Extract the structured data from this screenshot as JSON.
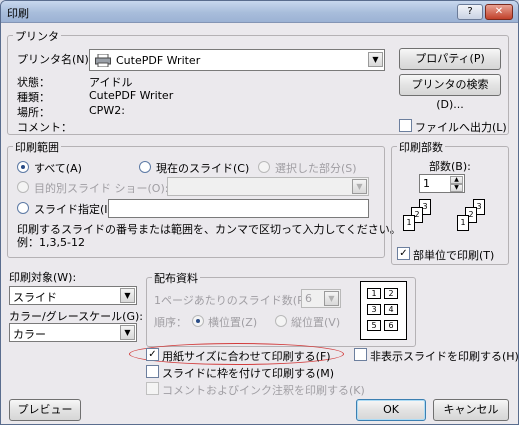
{
  "window": {
    "title": "印刷",
    "help": "?",
    "close": "✕"
  },
  "printer": {
    "legend": "プリンタ",
    "name_label": "プリンタ名(N):",
    "name_value": "CutePDF Writer",
    "properties_button": "プロパティ(P)",
    "find_button": "プリンタの検索(D)...",
    "status_label": "状態：",
    "status_value": "アイドル",
    "type_label": "種類：",
    "type_value": "CutePDF Writer",
    "where_label": "場所：",
    "where_value": "CPW2:",
    "comment_label": "コメント：",
    "print_to_file": "ファイルへ出力(L)"
  },
  "range": {
    "legend": "印刷範囲",
    "all": "すべて(A)",
    "current": "現在のスライド(C)",
    "selection": "選択した部分(S)",
    "custom_show": "目的別スライド ショー(O):",
    "slides": "スライド指定(I):",
    "hint_line1": "印刷するスライドの番号または範囲を、カンマで区切って入力してください。",
    "hint_line2": "例：1,3,5-12"
  },
  "copies": {
    "legend": "印刷部数",
    "count_label": "部数(B):",
    "count_value": "1",
    "collate": "部単位で印刷(T)",
    "pages": [
      "1",
      "2",
      "3",
      "1",
      "2",
      "3"
    ]
  },
  "print_what": {
    "label": "印刷対象(W):",
    "value": "スライド",
    "color_label": "カラー/グレースケール(G):",
    "color_value": "カラー"
  },
  "handouts": {
    "legend": "配布資料",
    "per_page_label": "1ページあたりのスライド数(R):",
    "per_page_value": "6",
    "order_label": "順序：",
    "horizontal": "横位置(Z)",
    "vertical": "縦位置(V)",
    "layout_numbers": [
      "1",
      "2",
      "3",
      "4",
      "5",
      "6"
    ]
  },
  "options": {
    "scale_to_fit": "用紙サイズに合わせて印刷する(F)",
    "frame_slides": "スライドに枠を付けて印刷する(M)",
    "comments": "コメントおよびインク注釈を印刷する(K)",
    "hidden_slides": "非表示スライドを印刷する(H)"
  },
  "footer": {
    "preview": "プレビュー(E)",
    "ok": "OK",
    "cancel": "キャンセル"
  },
  "colors": {
    "highlight_ellipse": "#d23c3c",
    "title_gradient": "#a8bddb"
  }
}
